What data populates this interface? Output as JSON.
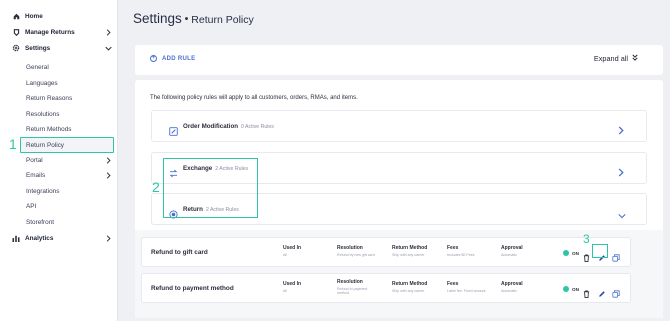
{
  "sidebar": {
    "items": [
      {
        "label": "Home",
        "icon": "home-icon"
      },
      {
        "label": "Manage Returns",
        "icon": "return-icon"
      },
      {
        "label": "Settings",
        "icon": "gear-icon"
      },
      {
        "label": "General"
      },
      {
        "label": "Languages"
      },
      {
        "label": "Return Reasons"
      },
      {
        "label": "Resolutions"
      },
      {
        "label": "Return Methods"
      },
      {
        "label": "Return Policy"
      },
      {
        "label": "Portal"
      },
      {
        "label": "Emails"
      },
      {
        "label": "Integrations"
      },
      {
        "label": "API"
      },
      {
        "label": "Storefront"
      },
      {
        "label": "Analytics",
        "icon": "analytics-icon"
      }
    ]
  },
  "header": {
    "title": "Settings",
    "separator": "•",
    "subtitle": "Return Policy"
  },
  "toolbar": {
    "add_rule": "ADD RULE",
    "expand_all": "Expand all"
  },
  "intro_text": "The following policy rules will apply to all customers, orders, RMAs, and items.",
  "policies": [
    {
      "title": "Order Modification",
      "count": "0 Active Rules"
    },
    {
      "title": "Exchange",
      "count": "2 Active Rules"
    },
    {
      "title": "Return",
      "count": "2 Active Rules"
    }
  ],
  "columns": {
    "used_in": "Used In",
    "resolution": "Resolution",
    "return_method": "Return Method",
    "fees": "Fees",
    "approval": "Approval"
  },
  "rules": [
    {
      "name": "Refund to gift card",
      "used_in": "All",
      "resolution": "Refund by new gift card",
      "return_method": "Ship with any carrier",
      "fees": "Includes $0 Fees",
      "approval": "Automatic",
      "status": "ON"
    },
    {
      "name": "Refund to payment method",
      "used_in": "All",
      "resolution": "Refund to payment method",
      "return_method": "Ship with any carrier",
      "fees": "Label fee: Fixed amount",
      "approval": "Automatic",
      "status": "ON"
    }
  ],
  "callouts": [
    "1",
    "2",
    "3"
  ],
  "colors": {
    "accent": "#2ec4a6",
    "link": "#4a6fd1",
    "on": "#2ec4a6",
    "background": "#eef0f3"
  }
}
